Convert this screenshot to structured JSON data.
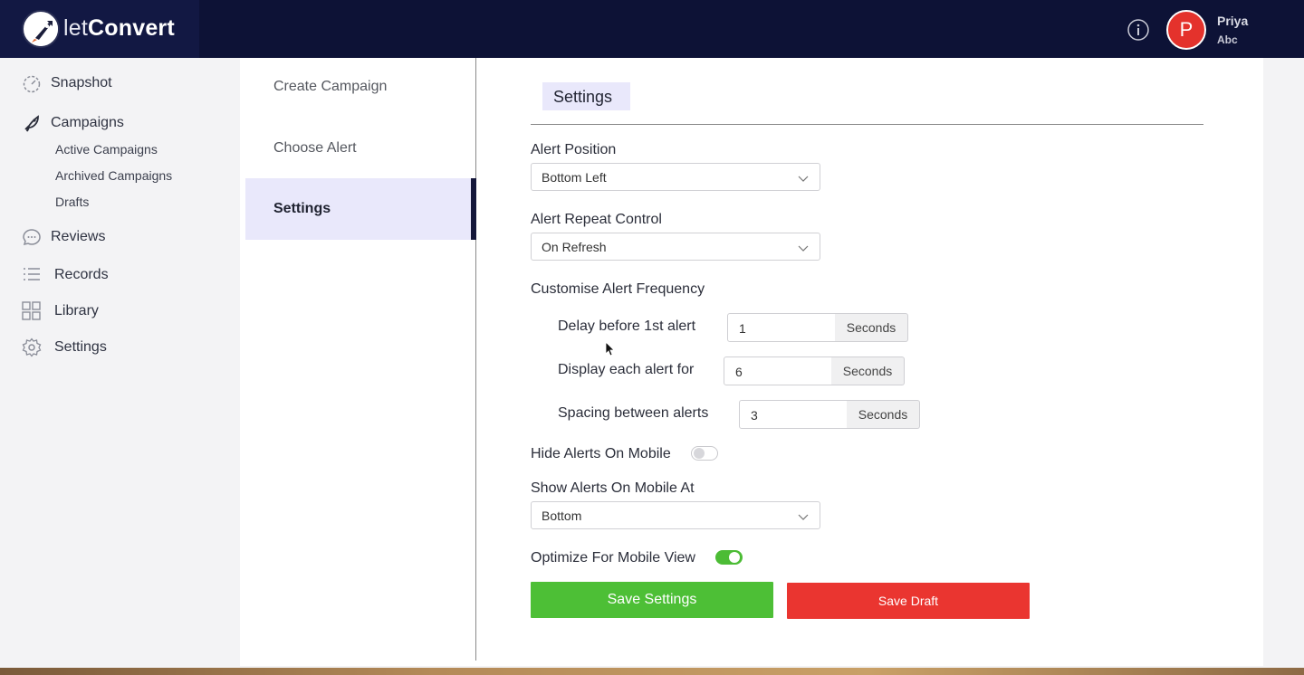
{
  "brand": {
    "name_light": "let",
    "name_bold": "Convert"
  },
  "user": {
    "initial": "P",
    "name": "Priya",
    "org": "Abc"
  },
  "sidebar": {
    "items": [
      {
        "label": "Snapshot",
        "icon": "gauge-icon"
      },
      {
        "label": "Campaigns",
        "icon": "rocket-icon"
      },
      {
        "label": "Reviews",
        "icon": "chat-bubble-icon"
      },
      {
        "label": "Records",
        "icon": "list-icon"
      },
      {
        "label": "Library",
        "icon": "grid-icon"
      },
      {
        "label": "Settings",
        "icon": "gear-icon"
      }
    ],
    "campaign_subitems": [
      "Active Campaigns",
      "Archived Campaigns",
      "Drafts"
    ]
  },
  "steps": [
    "Create Campaign",
    "Choose Alert",
    "Settings"
  ],
  "form": {
    "title": "Settings",
    "alert_position": {
      "label": "Alert Position",
      "value": "Bottom Left"
    },
    "repeat_control": {
      "label": "Alert Repeat Control",
      "value": "On Refresh"
    },
    "frequency": {
      "label": "Customise Alert Frequency",
      "delay": {
        "label": "Delay before 1st alert",
        "value": "1",
        "unit": "Seconds"
      },
      "display": {
        "label": "Display each alert for",
        "value": "6",
        "unit": "Seconds"
      },
      "spacing": {
        "label": "Spacing between alerts",
        "value": "3",
        "unit": "Seconds"
      }
    },
    "hide_mobile": {
      "label": "Hide Alerts On Mobile",
      "enabled": false
    },
    "mobile_position": {
      "label": "Show Alerts On Mobile At",
      "value": "Bottom"
    },
    "optimize_mobile": {
      "label": "Optimize For Mobile View",
      "enabled": true
    },
    "save_label": "Save Settings",
    "draft_label": "Save Draft"
  },
  "colors": {
    "topbar": "#0d1236",
    "accent": "#e9e8fb",
    "save": "#4dbf36",
    "draft": "#ea3530",
    "avatar": "#e4322c"
  }
}
